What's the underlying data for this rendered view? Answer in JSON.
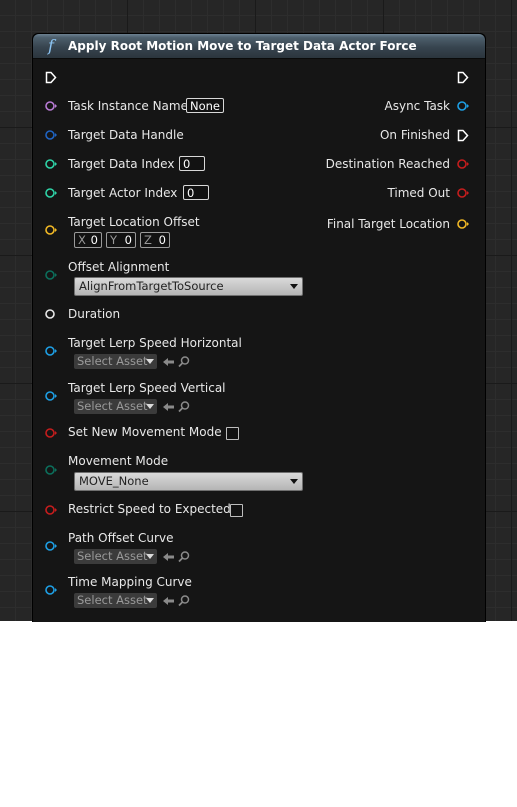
{
  "node": {
    "title": "Apply Root Motion Move to Target Data Actor Force",
    "title_icon": "function-icon"
  },
  "inputs": {
    "task_instance_name": {
      "label": "Task Instance Name",
      "value": "None"
    },
    "target_data_handle": {
      "label": "Target Data Handle"
    },
    "target_data_index": {
      "label": "Target Data Index",
      "value": "0"
    },
    "target_actor_index": {
      "label": "Target Actor Index",
      "value": "0"
    },
    "target_location_offset": {
      "label": "Target Location Offset",
      "x_axis": "X",
      "x": "0",
      "y_axis": "Y",
      "y": "0",
      "z_axis": "Z",
      "z": "0"
    },
    "offset_alignment": {
      "label": "Offset Alignment",
      "value": "AlignFromTargetToSource"
    },
    "duration": {
      "label": "Duration"
    },
    "target_lerp_speed_horizontal": {
      "label": "Target Lerp Speed Horizontal",
      "asset": "Select Asset"
    },
    "target_lerp_speed_vertical": {
      "label": "Target Lerp Speed Vertical",
      "asset": "Select Asset"
    },
    "set_new_movement_mode": {
      "label": "Set New Movement Mode",
      "checked": false
    },
    "movement_mode": {
      "label": "Movement Mode",
      "value": "MOVE_None"
    },
    "restrict_speed_to_expected": {
      "label": "Restrict Speed to Expected",
      "checked": false
    },
    "path_offset_curve": {
      "label": "Path Offset Curve",
      "asset": "Select Asset"
    },
    "time_mapping_curve": {
      "label": "Time Mapping Curve",
      "asset": "Select Asset"
    }
  },
  "outputs": {
    "async_task": {
      "label": "Async Task"
    },
    "on_finished": {
      "label": "On Finished"
    },
    "destination_reached": {
      "label": "Destination Reached"
    },
    "timed_out": {
      "label": "Timed Out"
    },
    "final_target_location": {
      "label": "Final Target Location"
    }
  },
  "pin_colors": {
    "object": "#b97cd6",
    "struct_blue": "#1f64c4",
    "integer": "#2fd4a8",
    "vector": "#f2b925",
    "enum": "#0c6f5c",
    "float": "#e8e8e8",
    "object_ref": "#1ea0e6",
    "delegate": "#c61d1d",
    "exec": "#ffffff"
  }
}
